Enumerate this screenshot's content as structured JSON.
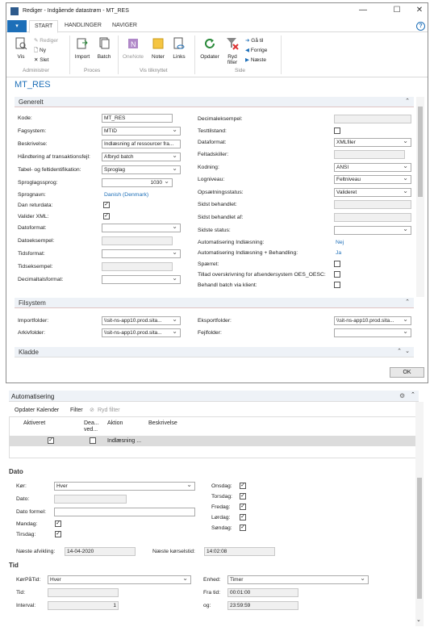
{
  "window": {
    "title": "Rediger - Indgående datastrøm - MT_RES",
    "controls": [
      "?",
      "—",
      "☐",
      "✕"
    ]
  },
  "ribbon": {
    "file_tab": "▾",
    "tabs": [
      "START",
      "HANDLINGER",
      "NAVIGER"
    ],
    "help": "?",
    "buttons": {
      "vis": "Vis",
      "rediger": "Rediger",
      "ny": "Ny",
      "slet": "Slet",
      "import": "Import",
      "batch": "Batch",
      "onenote": "OneNote",
      "noter": "Noter",
      "links": "Links",
      "opdater": "Opdater",
      "ryd_filter": "Ryd filter",
      "gaa_til": "Gå til",
      "forrige": "Forrige",
      "naeste": "Næste"
    },
    "groups": [
      "Administrer",
      "Proces",
      "Vis tilknyttet",
      "Side"
    ]
  },
  "page_title": "MT_RES",
  "generelt": {
    "header": "Generelt",
    "left": {
      "kode": {
        "label": "Kode:",
        "value": "MT_RES"
      },
      "fagsystem": {
        "label": "Fagsystem:",
        "value": "MTID"
      },
      "beskrivelse": {
        "label": "Beskrivelse:",
        "value": "Indlæsning af ressourcer fra..."
      },
      "haandtering": {
        "label": "Håndtering af transaktionsfejl:",
        "value": "Afbryd batch"
      },
      "tabel": {
        "label": "Tabel- og feltidentifikation:",
        "value": "Sproglag"
      },
      "sproglagssprog": {
        "label": "Sproglagssprog:",
        "value": "1030"
      },
      "sprognavn": {
        "label": "Sprognavn:",
        "value": "Danish (Denmark)"
      },
      "dan_returdata": {
        "label": "Dan returdata:",
        "checked": true
      },
      "valider_xml": {
        "label": "Valider XML:",
        "checked": true
      },
      "datoformat": {
        "label": "Datoformat:",
        "value": ""
      },
      "datoeksempel": {
        "label": "Datoeksempel:",
        "value": ""
      },
      "tidsformat": {
        "label": "Tidsformat:",
        "value": ""
      },
      "tidseksempel": {
        "label": "Tidseksempel:",
        "value": ""
      },
      "decimaltalsformat": {
        "label": "Decimaltalsformat:",
        "value": ""
      }
    },
    "right": {
      "decimaleksempel": {
        "label": "Decimaleksempel:",
        "value": ""
      },
      "testtilstand": {
        "label": "Testtilstand:",
        "checked": false
      },
      "dataformat": {
        "label": "Dataformat:",
        "value": "XMLfiler"
      },
      "feltadskiller": {
        "label": "Feltadskiller:",
        "value": ""
      },
      "kodning": {
        "label": "Kodning:",
        "value": "ANSI"
      },
      "logniveau": {
        "label": "Logniveau:",
        "value": "Feltniveau"
      },
      "opsaetningsstatus": {
        "label": "Opsætningsstatus:",
        "value": "Valideret"
      },
      "sidst_behandlet": {
        "label": "Sidst behandlet:",
        "value": ""
      },
      "sidst_behandlet_af": {
        "label": "Sidst behandlet af:",
        "value": ""
      },
      "sidste_status": {
        "label": "Sidste status:",
        "value": ""
      },
      "auto_indlaesning": {
        "label": "Automatisering Indlæsning:",
        "value": "Nej"
      },
      "auto_indl_behandling": {
        "label": "Automatisering Indlæsning + Behandling:",
        "value": "Ja"
      },
      "spaerret": {
        "label": "Spærret:",
        "checked": false
      },
      "tillad": {
        "label": "Tillad overskrivning for afsendersystem OES_OESC:",
        "checked": false
      },
      "behandl_batch": {
        "label": "Behandl batch via klient:",
        "checked": false
      }
    }
  },
  "filsystem": {
    "header": "Filsystem",
    "importfolder": {
      "label": "Importfolder:",
      "value": "\\\\sit-ns-app10.prod.sita..."
    },
    "arkivfolder": {
      "label": "Arkivfolder:",
      "value": "\\\\sit-ns-app10.prod.sita..."
    },
    "eksportfolder": {
      "label": "Eksportfolder:",
      "value": "\\\\sit-ns-app10.prod.sita..."
    },
    "fejlfolder": {
      "label": "Fejlfolder:",
      "value": ""
    }
  },
  "kladde": {
    "header": "Kladde"
  },
  "ok_label": "OK",
  "automatisering": {
    "header": "Automatisering",
    "toolbar": {
      "opdater": "Opdater Kalender",
      "filter": "Filter",
      "ryd_filter": "Ryd filter"
    },
    "columns": {
      "aktiveret": "Aktiveret",
      "deaktiver": "Dea...\nved...",
      "aktion": "Aktion",
      "beskrivelse": "Beskrivelse"
    },
    "row": {
      "aktiveret": true,
      "deaktiver": false,
      "aktion": "Indlæsning ..."
    }
  },
  "dato": {
    "header": "Dato",
    "koer": {
      "label": "Kør:",
      "value": "Hver"
    },
    "dato": {
      "label": "Dato:",
      "value": ""
    },
    "datoformel": {
      "label": "Dato formel:",
      "value": ""
    },
    "mandag": {
      "label": "Mandag:",
      "checked": true
    },
    "tirsdag": {
      "label": "Tirsdag:",
      "checked": true
    },
    "onsdag": {
      "label": "Onsdag:",
      "checked": true
    },
    "torsdag": {
      "label": "Torsdag:",
      "checked": true
    },
    "fredag": {
      "label": "Fredag:",
      "checked": true
    },
    "loerdag": {
      "label": "Lørdag:",
      "checked": true
    },
    "soendag": {
      "label": "Søndag:",
      "checked": true
    },
    "naeste_afvikling": {
      "label": "Næste afvikling:",
      "value": "14-04-2020"
    },
    "naeste_koerselstid": {
      "label": "Næste kørselstid:",
      "value": "14:02:08"
    }
  },
  "tid": {
    "header": "Tid",
    "koerpaatid": {
      "label": "KørPåTid:",
      "value": "Hver"
    },
    "tid": {
      "label": "Tid:",
      "value": ""
    },
    "interval": {
      "label": "Interval:",
      "value": "1"
    },
    "enhed": {
      "label": "Enhed:",
      "value": "Timer"
    },
    "fra_tid": {
      "label": "Fra tid:",
      "value": "00:01:00"
    },
    "og": {
      "label": "og:",
      "value": "23:59:59"
    }
  }
}
